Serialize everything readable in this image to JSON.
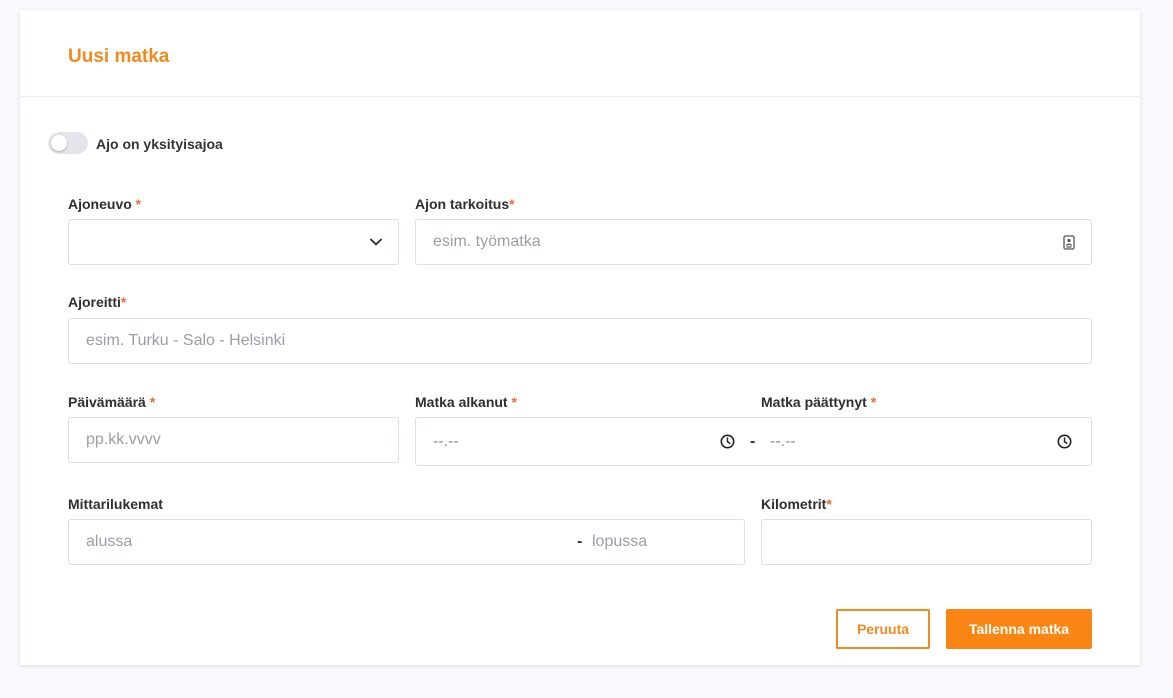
{
  "form": {
    "title": "Uusi matka",
    "private_toggle_label": "Ajo on yksityisajoa",
    "required_mark": "*",
    "vehicle": {
      "label": "Ajoneuvo",
      "value": ""
    },
    "purpose": {
      "label": "Ajon tarkoitus",
      "placeholder": "esim. työmatka"
    },
    "route": {
      "label": "Ajoreitti",
      "placeholder": "esim. Turku - Salo - Helsinki"
    },
    "date": {
      "label": "Päivämäärä",
      "placeholder": "pp.kk.vvvv"
    },
    "start_time": {
      "label": "Matka alkanut",
      "placeholder": "--.--"
    },
    "end_time": {
      "label": "Matka päättynyt",
      "placeholder": "--.--"
    },
    "time_separator": "-",
    "odometer": {
      "label": "Mittarilukemat",
      "start_placeholder": "alussa",
      "end_placeholder": "lopussa",
      "separator": "-"
    },
    "kilometers": {
      "label": "Kilometrit",
      "value": ""
    },
    "cancel_label": "Peruuta",
    "save_label": "Tallenna matka"
  },
  "colors": {
    "accent": "#f28a1e",
    "primary_button": "#f98614",
    "required": "#f06a35"
  },
  "icons": {
    "vehicle_dropdown": "chevron-down-icon",
    "purpose_field": "contact-card-icon",
    "time": "clock-icon"
  }
}
